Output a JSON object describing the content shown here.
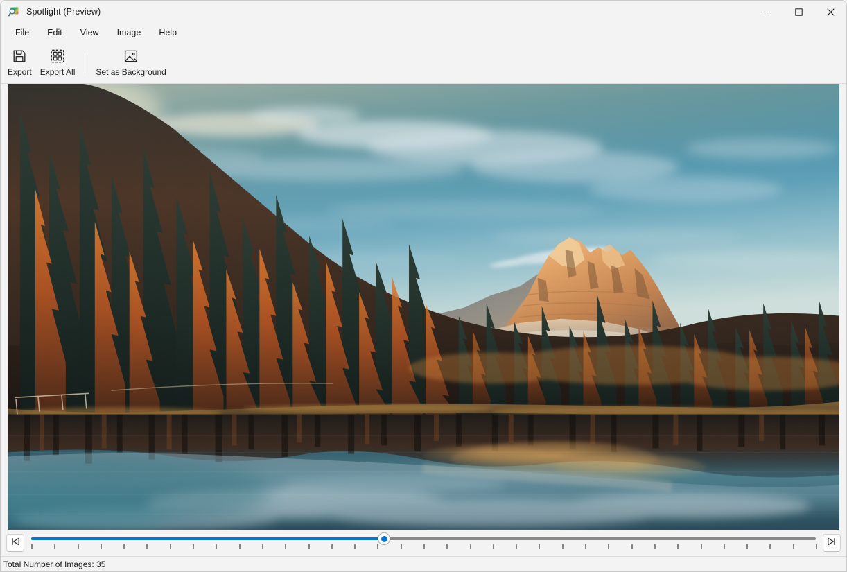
{
  "window": {
    "title": "Spotlight (Preview)",
    "app_icon": "spotlight-magnifier-icon",
    "controls": {
      "minimize": "minimize-icon",
      "maximize": "maximize-icon",
      "close": "close-icon"
    }
  },
  "menubar": {
    "items": [
      {
        "label": "File"
      },
      {
        "label": "Edit"
      },
      {
        "label": "View"
      },
      {
        "label": "Image"
      },
      {
        "label": "Help"
      }
    ]
  },
  "toolbar": {
    "buttons": [
      {
        "label": "Export",
        "icon": "floppy-disk-save-icon"
      },
      {
        "label": "Export All",
        "icon": "grid-export-all-icon"
      },
      {
        "label": "Set as Background",
        "icon": "picture-frame-icon"
      }
    ]
  },
  "viewer": {
    "image_description": "Mountain lake at sunset with autumn larch forest and mirror reflection",
    "image_alt": "Dolomites peak glowing orange at sunset above a still alpine lake reflecting the forest and sky"
  },
  "playbar": {
    "previous_button": "skip-to-first-icon",
    "next_button": "skip-to-last-icon",
    "slider": {
      "value": 15,
      "min": 1,
      "max": 35,
      "tick_count": 35,
      "fill_percent": 45,
      "accent_color": "#0078d4",
      "track_color": "#868686"
    }
  },
  "statusbar": {
    "text": "Total Number of Images: 35"
  },
  "colors": {
    "accent": "#0078d4",
    "chrome": "#f3f3f3",
    "text": "#1b1b1b",
    "border": "#dcdcdc"
  }
}
